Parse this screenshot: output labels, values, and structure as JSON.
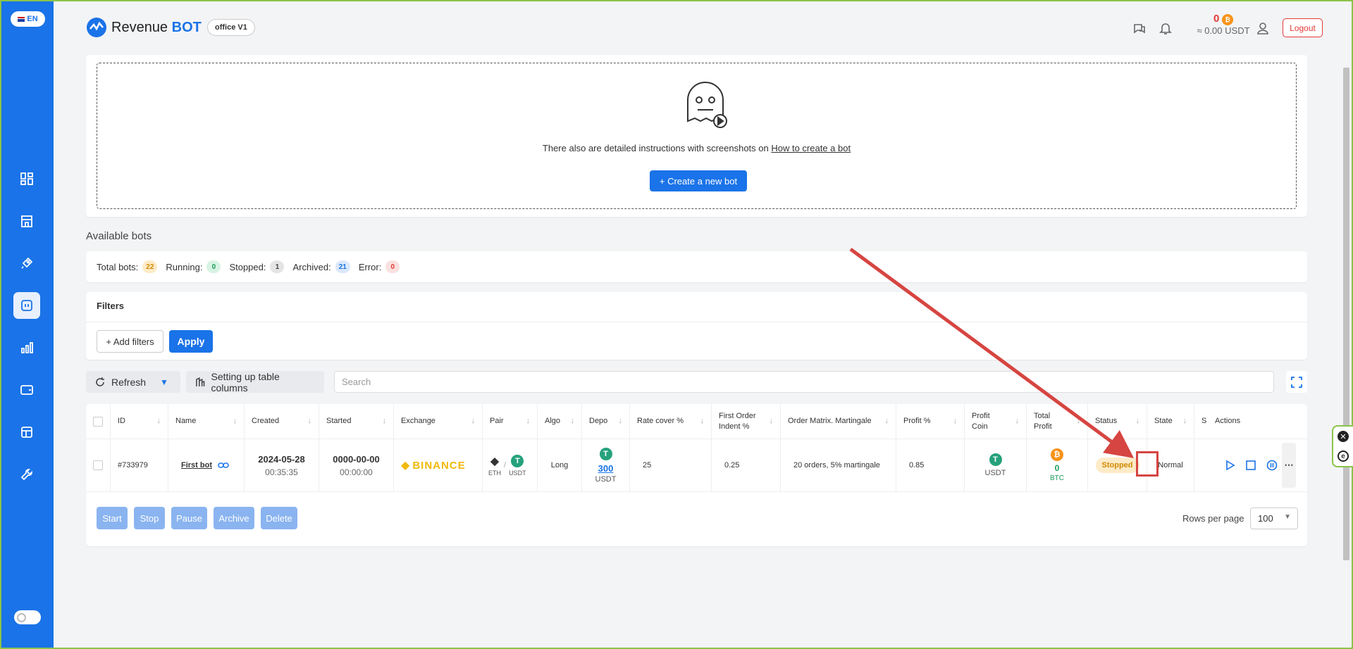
{
  "lang": "EN",
  "app": {
    "brand_revenue": "Revenue",
    "brand_bot": "BOT",
    "office": "office V1"
  },
  "header": {
    "balance_count": "0",
    "balance_usdt": "≈ 0.00 USDT",
    "logout": "Logout"
  },
  "create": {
    "instructions_prefix": "There also are detailed instructions with screenshots on ",
    "instructions_link": "How to create a bot",
    "button": "+ Create a new bot"
  },
  "bots": {
    "title": "Available bots",
    "stats": [
      {
        "label": "Total bots:",
        "value": "22"
      },
      {
        "label": "Running:",
        "value": "0"
      },
      {
        "label": "Stopped:",
        "value": "1"
      },
      {
        "label": "Archived:",
        "value": "21"
      },
      {
        "label": "Error:",
        "value": "0"
      }
    ]
  },
  "filters": {
    "title": "Filters",
    "add": "+ Add filters",
    "apply": "Apply"
  },
  "toolbar": {
    "refresh": "Refresh",
    "columns": "Setting up table columns",
    "search_placeholder": "Search"
  },
  "table": {
    "headers": [
      "ID",
      "Name",
      "Created",
      "Started",
      "Exchange",
      "Pair",
      "Algo",
      "Depo",
      "Rate cover %",
      "First Order Indent %",
      "Order Matrix. Martingale",
      "Profit %",
      "Profit Coin",
      "Total Profit",
      "Status",
      "State",
      "S",
      "Actions"
    ],
    "row": {
      "id": "#733979",
      "name": "First bot",
      "created_date": "2024-05-28",
      "created_time": "00:35:35",
      "started_date": "0000-00-00",
      "started_time": "00:00:00",
      "exchange": "BINANCE",
      "pair_base": "ETH",
      "pair_sep": "/",
      "pair_quote": "USDT",
      "algo": "Long",
      "depo_value": "300",
      "depo_coin": "USDT",
      "rate_cover": "25",
      "first_indent": "0.25",
      "matrix": "20 orders, 5% martingale",
      "profit_pct": "0.85",
      "profit_coin": "USDT",
      "total_profit": "0",
      "total_profit_coin": "BTC",
      "status": "Stopped",
      "state": "Normal"
    }
  },
  "bulk": {
    "start": "Start",
    "stop": "Stop",
    "pause": "Pause",
    "archive": "Archive",
    "delete": "Delete"
  },
  "pagination": {
    "rows_label": "Rows per page",
    "rows_value": "100"
  }
}
